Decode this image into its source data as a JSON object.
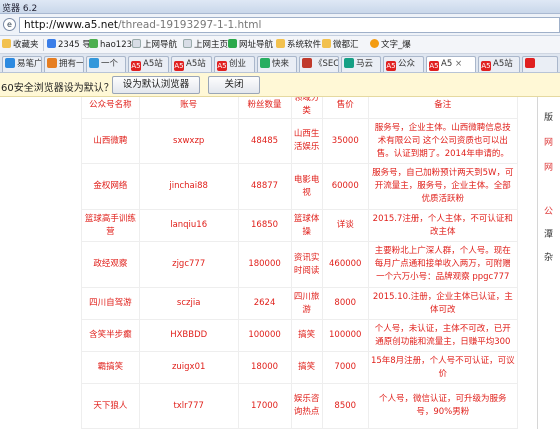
{
  "window": {
    "title": "览器 6.2"
  },
  "address_bar": {
    "url_host": "http://www.a5.net",
    "url_path": "/thread-19193297-1-1.html"
  },
  "favorites": [
    {
      "label": "收藏夹",
      "icon": "folder-star-icon"
    },
    {
      "label": "2345 导",
      "icon": "2345-icon"
    },
    {
      "label": "hao123",
      "icon": "hao123-icon"
    },
    {
      "label": "上网导航",
      "icon": "page-icon"
    },
    {
      "label": "上网主页",
      "icon": "page-icon"
    },
    {
      "label": "网址导航",
      "icon": "globe-icon"
    },
    {
      "label": "系统软件",
      "icon": "folder-icon"
    },
    {
      "label": "微都汇",
      "icon": "folder-icon"
    },
    {
      "label": "文字_爆",
      "icon": "star-icon"
    }
  ],
  "tabs": [
    {
      "label": "易笔广",
      "badge": ""
    },
    {
      "label": "拥有一",
      "badge": ""
    },
    {
      "label": "一个",
      "badge": ""
    },
    {
      "label": "A5站",
      "badge": "A5"
    },
    {
      "label": "A5站",
      "badge": "A5"
    },
    {
      "label": "创业",
      "badge": "A5"
    },
    {
      "label": "快来",
      "badge": ""
    },
    {
      "label": "《SEC",
      "badge": ""
    },
    {
      "label": "马云",
      "badge": ""
    },
    {
      "label": "公众",
      "badge": "A5"
    },
    {
      "label": "A5",
      "badge": "A5"
    },
    {
      "label": "A5站",
      "badge": "A5"
    }
  ],
  "notice": {
    "text": "60安全浏览器设为默认？",
    "set_default_label": "设为默认浏览器",
    "close_label": "关闭"
  },
  "table": {
    "headers": [
      "公众号名称",
      "账号",
      "粉丝数量",
      "领域分类",
      "售价",
      "备注"
    ],
    "rows": [
      [
        "山西微聘",
        "sxwxzp",
        "48485",
        "山西生活娱乐",
        "35000",
        "服务号，企业主体。山西微聘信息技术有限公司 这个公司资质也可以出售。认证到期了。2014年申请的。"
      ],
      [
        "金权网络",
        "jinchai88",
        "48877",
        "电影电视",
        "60000",
        "服务号，自己加粉预计两天到5W，可开流量主，服务号，企业主体。全部优质活跃粉"
      ],
      [
        "篮球高手训练营",
        "lanqiu16",
        "16850",
        "篮球体操",
        "详谈",
        "2015.7注册，个人主体，不可认证和改主体"
      ],
      [
        "政经观察",
        "zjgc777",
        "180000",
        "资讯实时阅读",
        "460000",
        "主要粉北上广深人群，个人号。现在每月广点通和接单收入两万，可附赠一个六万小号：品牌观察 ppgc777"
      ],
      [
        "四川自驾游",
        "sczjia",
        "2624",
        "四川旅游",
        "8000",
        "2015.10.注册，企业主体已认证，主体可改"
      ],
      [
        "含笑半步癫",
        "HXBBDD",
        "100000",
        "搞笑",
        "100000",
        "个人号，未认证，主体不可改，已开通原创功能和流量主，日赚平均300"
      ],
      [
        "霸搞笑",
        "zuigx01",
        "18000",
        "搞笑",
        "7000",
        "15年8月注册，个人号不可认证，可议价"
      ],
      [
        "天下狼人",
        "txlr777",
        "17000",
        "娱乐咨询热点",
        "8500",
        "个人号，微信认证，可升级为服务号，90%男粉"
      ]
    ]
  },
  "sidebar": {
    "items": [
      "版",
      "网",
      "网",
      "公",
      "潭",
      "杂"
    ]
  },
  "colors": {
    "table_text": "#e0201b",
    "notice_bg": "#fff8d6"
  }
}
